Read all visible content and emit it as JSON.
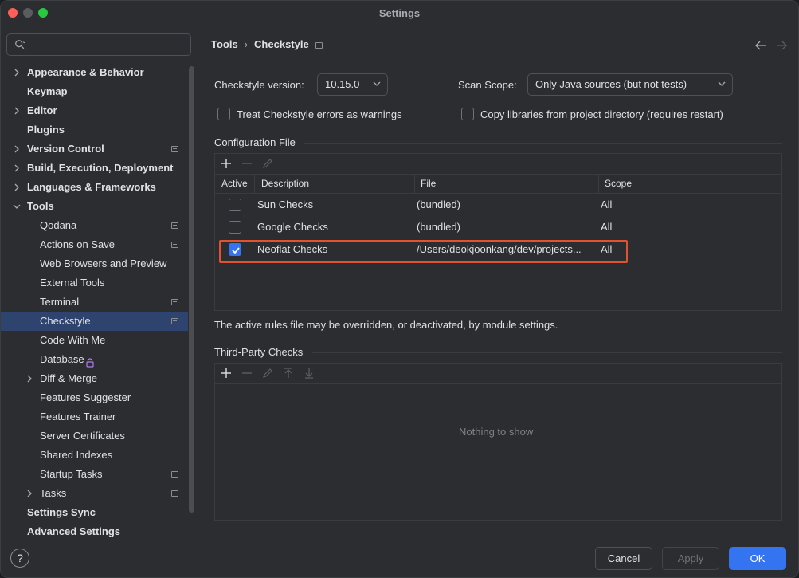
{
  "window": {
    "title": "Settings"
  },
  "search": {
    "placeholder": ""
  },
  "sidebar": {
    "items": [
      {
        "label": "Appearance & Behavior",
        "bold": true,
        "expandable": true,
        "expanded": false,
        "pinned": false
      },
      {
        "label": "Keymap",
        "bold": true,
        "expandable": false,
        "pinned": false
      },
      {
        "label": "Editor",
        "bold": true,
        "expandable": true,
        "expanded": false,
        "pinned": false
      },
      {
        "label": "Plugins",
        "bold": true,
        "expandable": false,
        "pinned": false
      },
      {
        "label": "Version Control",
        "bold": true,
        "expandable": true,
        "expanded": false,
        "pinned": true
      },
      {
        "label": "Build, Execution, Deployment",
        "bold": true,
        "expandable": true,
        "expanded": false,
        "pinned": false
      },
      {
        "label": "Languages & Frameworks",
        "bold": true,
        "expandable": true,
        "expanded": false,
        "pinned": false
      },
      {
        "label": "Tools",
        "bold": true,
        "expandable": true,
        "expanded": true,
        "pinned": false
      },
      {
        "label": "Qodana",
        "bold": false,
        "pinned": true
      },
      {
        "label": "Actions on Save",
        "bold": false,
        "pinned": true
      },
      {
        "label": "Web Browsers and Preview",
        "bold": false,
        "pinned": false
      },
      {
        "label": "External Tools",
        "bold": false,
        "pinned": false
      },
      {
        "label": "Terminal",
        "bold": false,
        "pinned": true
      },
      {
        "label": "Checkstyle",
        "bold": false,
        "pinned": true,
        "selected": true
      },
      {
        "label": "Code With Me",
        "bold": false,
        "pinned": false
      },
      {
        "label": "Database",
        "bold": false,
        "pinned": false,
        "locked": true
      },
      {
        "label": "Diff & Merge",
        "bold": false,
        "expandable": true,
        "expanded": false,
        "pinned": false
      },
      {
        "label": "Features Suggester",
        "bold": false,
        "pinned": false
      },
      {
        "label": "Features Trainer",
        "bold": false,
        "pinned": false
      },
      {
        "label": "Server Certificates",
        "bold": false,
        "pinned": false
      },
      {
        "label": "Shared Indexes",
        "bold": false,
        "pinned": false
      },
      {
        "label": "Startup Tasks",
        "bold": false,
        "pinned": true
      },
      {
        "label": "Tasks",
        "bold": false,
        "expandable": true,
        "expanded": false,
        "pinned": true
      },
      {
        "label": "Settings Sync",
        "bold": true,
        "expandable": false,
        "pinned": false
      },
      {
        "label": "Advanced Settings",
        "bold": true,
        "expandable": false,
        "pinned": false
      }
    ]
  },
  "breadcrumb": {
    "parent": "Tools",
    "separator": "›",
    "current": "Checkstyle"
  },
  "form": {
    "version_label": "Checkstyle version:",
    "version_value": "10.15.0",
    "scope_label": "Scan Scope:",
    "scope_value": "Only Java sources (but not tests)",
    "treat_warnings_label": "Treat Checkstyle errors as warnings",
    "treat_warnings_checked": false,
    "copy_libs_label": "Copy libraries from project directory (requires restart)",
    "copy_libs_checked": false
  },
  "config_file": {
    "section_title": "Configuration File",
    "columns": [
      "Active",
      "Description",
      "File",
      "Scope"
    ],
    "rows": [
      {
        "active": false,
        "description": "Sun Checks",
        "file": "(bundled)",
        "scope": "All"
      },
      {
        "active": false,
        "description": "Google Checks",
        "file": "(bundled)",
        "scope": "All"
      },
      {
        "active": true,
        "description": "Neoflat Checks",
        "file": "/Users/deokjoonkang/dev/projects...",
        "scope": "All"
      }
    ],
    "hint": "The active rules file may be overridden, or deactivated, by module settings."
  },
  "third_party": {
    "section_title": "Third-Party Checks",
    "empty_text": "Nothing to show"
  },
  "buttons": {
    "help": "?",
    "cancel": "Cancel",
    "apply": "Apply",
    "ok": "OK"
  },
  "colors": {
    "accent": "#3574f0",
    "selection": "#2e436e",
    "highlight_border": "#e2522f",
    "background": "#2b2d30"
  }
}
